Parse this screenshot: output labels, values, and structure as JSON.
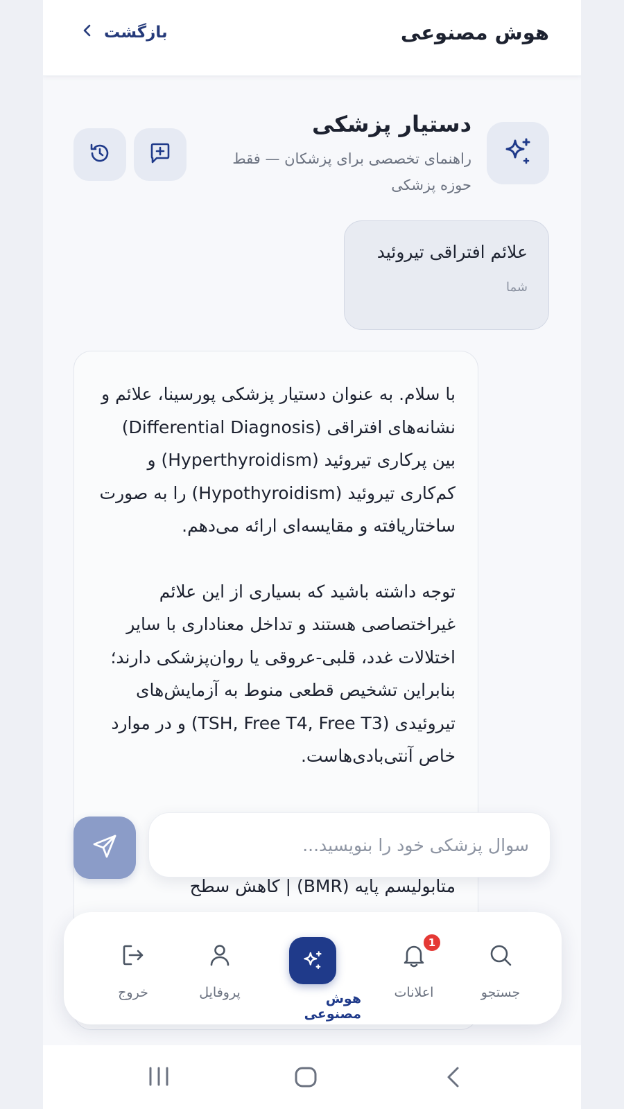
{
  "topbar": {
    "title": "هوش مصنوعی",
    "back_label": "بازگشت"
  },
  "assistant": {
    "name": "دستیار پزشکی",
    "description": "راهنمای تخصصی برای پزشکان — فقط حوزه پزشکی"
  },
  "user_message": {
    "text": "علائم افتراقی تیروئید",
    "sender": "شما"
  },
  "ai_message": {
    "paragraph_1": "با سلام. به عنوان دستیار پزشکی پورسینا، علائم و نشانه‌های افتراقی (Differential Diagnosis) بین پرکاری تیروئید (Hyperthyroidism) و کم‌کاری تیروئید (Hypothyroidism) را به صورت ساختاریافته و مقایسه‌ای ارائه می‌دهم.",
    "paragraph_2": "توجه داشته باشید که بسیاری از این علائم غیراختصاصی هستند و تداخل معناداری با سایر اختلالات غدد، قلبی-عروقی یا روان‌پزشکی دارند؛ بنابراین تشخیص قطعی منوط به آزمایش‌های تیروئیدی (TSH, Free T4, Free T3) و در موارد خاص آنتی‌بادی‌هاست.",
    "partial_line": "متابولیسم پایه (BMR) | کاهش سطح"
  },
  "composer": {
    "placeholder": "سوال پزشکی خود را بنویسید..."
  },
  "bottom_nav": {
    "items": [
      {
        "label": "جستجو",
        "icon": "search-icon"
      },
      {
        "label": "اعلانات",
        "icon": "bell-icon",
        "badge": "1"
      },
      {
        "label": "هوش مصنوعی",
        "icon": "sparkle-icon",
        "active": true
      },
      {
        "label": "پروفایل",
        "icon": "user-icon"
      },
      {
        "label": "خروج",
        "icon": "logout-icon"
      }
    ]
  },
  "colors": {
    "primary": "#1f3a8a",
    "send_button": "#8b9cc8",
    "badge": "#e53935"
  }
}
